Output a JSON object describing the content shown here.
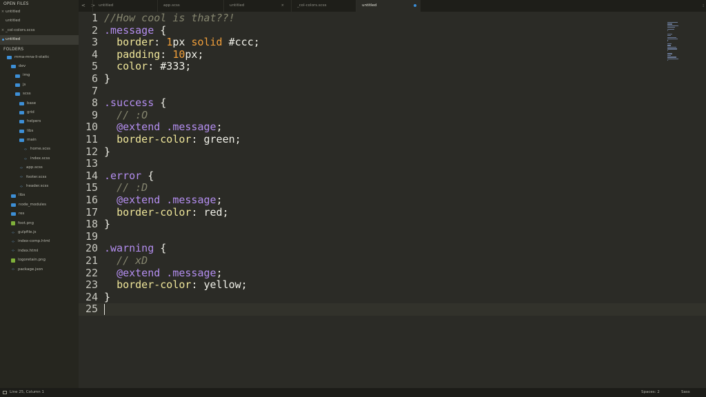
{
  "sidebar": {
    "open_files_header": "OPEN FILES",
    "open_files": [
      {
        "label": "untitled",
        "marker": "x"
      },
      {
        "label": "untitled",
        "marker": ""
      },
      {
        "label": "_col-colors.scss",
        "marker": "x"
      },
      {
        "label": "untitled",
        "marker": "dot",
        "selected": true
      }
    ],
    "folders_header": "FOLDERS",
    "tree": [
      {
        "label": "mma-mna-li-static",
        "depth": 0,
        "kind": "folder-open"
      },
      {
        "label": "dev",
        "depth": 1,
        "kind": "folder-open"
      },
      {
        "label": "img",
        "depth": 2,
        "kind": "folder"
      },
      {
        "label": "js",
        "depth": 2,
        "kind": "folder"
      },
      {
        "label": "scss",
        "depth": 2,
        "kind": "folder-open"
      },
      {
        "label": "base",
        "depth": 3,
        "kind": "folder"
      },
      {
        "label": "grid",
        "depth": 3,
        "kind": "folder"
      },
      {
        "label": "helpers",
        "depth": 3,
        "kind": "folder"
      },
      {
        "label": "libs",
        "depth": 3,
        "kind": "folder"
      },
      {
        "label": "main",
        "depth": 3,
        "kind": "folder-open"
      },
      {
        "label": "home.scss",
        "depth": 4,
        "kind": "file"
      },
      {
        "label": "index.scss",
        "depth": 4,
        "kind": "file"
      },
      {
        "label": "app.scss",
        "depth": 3,
        "kind": "file"
      },
      {
        "label": "footer.scss",
        "depth": 3,
        "kind": "file"
      },
      {
        "label": "header.scss",
        "depth": 3,
        "kind": "file"
      },
      {
        "label": "libs",
        "depth": 1,
        "kind": "folder"
      },
      {
        "label": "node_modules",
        "depth": 1,
        "kind": "folder"
      },
      {
        "label": "res",
        "depth": 1,
        "kind": "folder"
      },
      {
        "label": "foot.png",
        "depth": 1,
        "kind": "image"
      },
      {
        "label": "gulpfile.js",
        "depth": 1,
        "kind": "file"
      },
      {
        "label": "index-comp.html",
        "depth": 1,
        "kind": "file"
      },
      {
        "label": "index.html",
        "depth": 1,
        "kind": "file"
      },
      {
        "label": "logoretain.png",
        "depth": 1,
        "kind": "image"
      },
      {
        "label": "package.json",
        "depth": 1,
        "kind": "file"
      }
    ]
  },
  "tabbar": {
    "nav": "< >",
    "tabs": [
      {
        "label": "untitled",
        "active": false,
        "indicator": ""
      },
      {
        "label": "app.scss",
        "active": false,
        "indicator": ""
      },
      {
        "label": "untitled",
        "active": false,
        "indicator": "x"
      },
      {
        "label": "_col-colors.scss",
        "active": false,
        "indicator": ""
      },
      {
        "label": "untitled",
        "active": true,
        "indicator": "dot"
      }
    ],
    "menu": "⁝"
  },
  "editor": {
    "current_line": 25,
    "lines": [
      [
        {
          "t": "//How cool is that??!",
          "c": "cm"
        }
      ],
      [
        {
          "t": ".message",
          "c": "sel-c"
        },
        {
          "t": " {",
          "c": ""
        }
      ],
      [
        {
          "t": "  ",
          "c": ""
        },
        {
          "t": "border",
          "c": "prop"
        },
        {
          "t": ": ",
          "c": ""
        },
        {
          "t": "1",
          "c": "num"
        },
        {
          "t": "px ",
          "c": ""
        },
        {
          "t": "solid",
          "c": "kw"
        },
        {
          "t": " #ccc;",
          "c": ""
        }
      ],
      [
        {
          "t": "  ",
          "c": ""
        },
        {
          "t": "padding",
          "c": "prop"
        },
        {
          "t": ": ",
          "c": ""
        },
        {
          "t": "10",
          "c": "num"
        },
        {
          "t": "px;",
          "c": ""
        }
      ],
      [
        {
          "t": "  ",
          "c": ""
        },
        {
          "t": "color",
          "c": "prop"
        },
        {
          "t": ": #333;",
          "c": ""
        }
      ],
      [
        {
          "t": "}",
          "c": ""
        }
      ],
      [
        {
          "t": "",
          "c": ""
        }
      ],
      [
        {
          "t": ".success",
          "c": "sel-c"
        },
        {
          "t": " {",
          "c": ""
        }
      ],
      [
        {
          "t": "  ",
          "c": ""
        },
        {
          "t": "// :O",
          "c": "cm"
        }
      ],
      [
        {
          "t": "  ",
          "c": ""
        },
        {
          "t": "@extend",
          "c": "at"
        },
        {
          "t": " .message",
          "c": "sel-c"
        },
        {
          "t": ";",
          "c": ""
        }
      ],
      [
        {
          "t": "  ",
          "c": ""
        },
        {
          "t": "border-color",
          "c": "prop"
        },
        {
          "t": ": green;",
          "c": ""
        }
      ],
      [
        {
          "t": "}",
          "c": ""
        }
      ],
      [
        {
          "t": "",
          "c": ""
        }
      ],
      [
        {
          "t": ".error",
          "c": "sel-c"
        },
        {
          "t": " {",
          "c": ""
        }
      ],
      [
        {
          "t": "  ",
          "c": ""
        },
        {
          "t": "// :D",
          "c": "cm"
        }
      ],
      [
        {
          "t": "  ",
          "c": ""
        },
        {
          "t": "@extend",
          "c": "at"
        },
        {
          "t": " .message",
          "c": "sel-c"
        },
        {
          "t": ";",
          "c": ""
        }
      ],
      [
        {
          "t": "  ",
          "c": ""
        },
        {
          "t": "border-color",
          "c": "prop"
        },
        {
          "t": ": red;",
          "c": ""
        }
      ],
      [
        {
          "t": "}",
          "c": ""
        }
      ],
      [
        {
          "t": "",
          "c": ""
        }
      ],
      [
        {
          "t": ".warning",
          "c": "sel-c"
        },
        {
          "t": " {",
          "c": ""
        }
      ],
      [
        {
          "t": "  ",
          "c": ""
        },
        {
          "t": "// xD",
          "c": "cm"
        }
      ],
      [
        {
          "t": "  ",
          "c": ""
        },
        {
          "t": "@extend",
          "c": "at"
        },
        {
          "t": " .message",
          "c": "sel-c"
        },
        {
          "t": ";",
          "c": ""
        }
      ],
      [
        {
          "t": "  ",
          "c": ""
        },
        {
          "t": "border-color",
          "c": "prop"
        },
        {
          "t": ": yellow;",
          "c": ""
        }
      ],
      [
        {
          "t": "}",
          "c": ""
        }
      ],
      [
        {
          "t": "",
          "c": ""
        }
      ]
    ]
  },
  "statusbar": {
    "position": "Line 25, Column 1",
    "spaces": "Spaces: 2",
    "syntax": "Sass"
  },
  "colors": {
    "background": "#2b2b26",
    "sidebar": "#26261f",
    "comment": "#86866f",
    "selector": "#b48ef0",
    "property": "#efe69a",
    "number": "#f3a03a",
    "accent_blue": "#3a8ed8"
  }
}
